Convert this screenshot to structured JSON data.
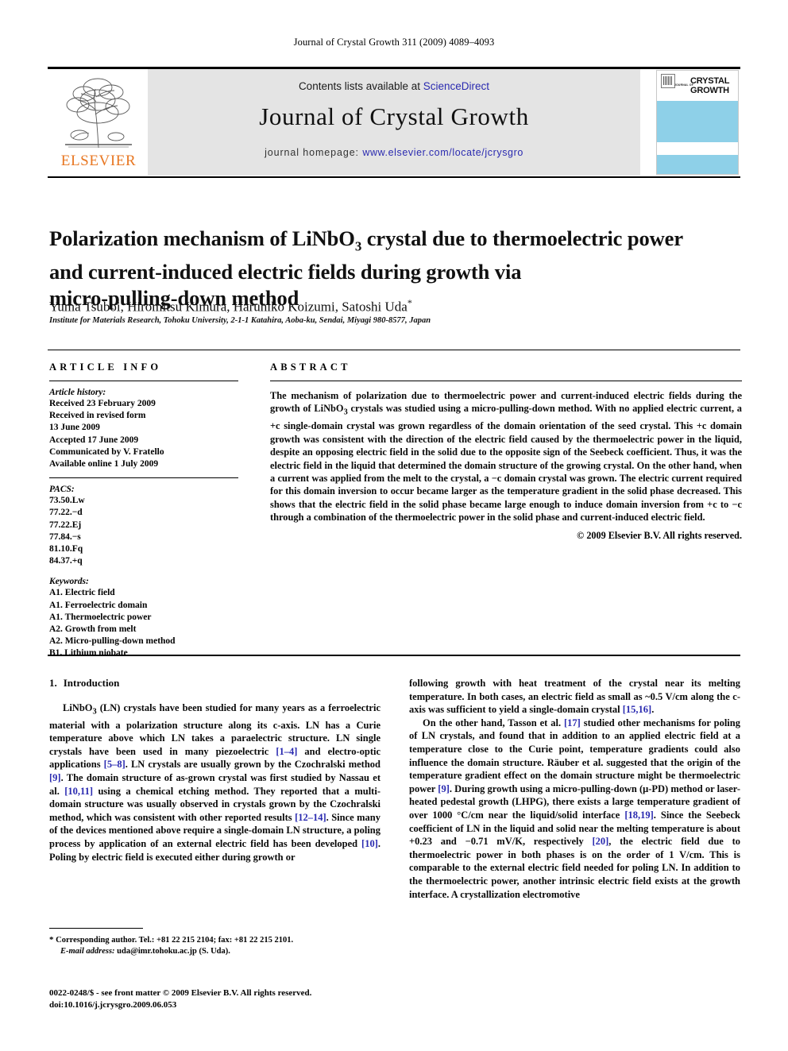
{
  "running_head": "Journal of Crystal Growth 311 (2009) 4089–4093",
  "masthead": {
    "contents_prefix": "Contents lists available at ",
    "sciencedirect": "ScienceDirect",
    "journal_name": "Journal of Crystal Growth",
    "homepage_prefix": "journal homepage: ",
    "homepage_url": "www.elsevier.com/locate/jcrysgro",
    "publisher_wordmark": "ELSEVIER",
    "link_color": "#2a2ab0",
    "band_color": "#e4e4e4",
    "wordmark_color": "#e87722"
  },
  "cover": {
    "subtitle": "JOURNAL OF",
    "title_line1": "CRYSTAL",
    "title_line2": "GROWTH",
    "accent_color": "#8ed0e8"
  },
  "article": {
    "title_line1": "Polarization mechanism of LiNbO",
    "title_sub1": "3",
    "title_line1b": " crystal due to thermoelectric power",
    "title_line2": "and current-induced electric fields during growth via",
    "title_line3": "micro-pulling-down method",
    "authors": "Yuma Tsuboi, Hiromitsu Kimura, Haruhiko Koizumi, Satoshi Uda",
    "corresponding_marker": "*",
    "affiliation": "Institute for Materials Research, Tohoku University, 2-1-1 Katahira, Aoba-ku, Sendai, Miyagi 980-8577, Japan"
  },
  "article_info": {
    "heading": "ARTICLE INFO",
    "history_label": "Article history:",
    "history": [
      "Received 23 February 2009",
      "Received in revised form",
      "13 June 2009",
      "Accepted 17 June 2009",
      "Communicated by V. Fratello",
      "Available online 1 July 2009"
    ],
    "pacs_label": "PACS:",
    "pacs": [
      "73.50.Lw",
      "77.22.−d",
      "77.22.Ej",
      "77.84.−s",
      "81.10.Fq",
      "84.37.+q"
    ],
    "keywords_label": "Keywords:",
    "keywords": [
      "A1. Electric field",
      "A1. Ferroelectric domain",
      "A1. Thermoelectric power",
      "A2. Growth from melt",
      "A2. Micro-pulling-down method",
      "B1. Lithium niobate"
    ]
  },
  "abstract": {
    "heading": "ABSTRACT",
    "text": "The mechanism of polarization due to thermoelectric power and current-induced electric fields during the growth of LiNbO3 crystals was studied using a micro-pulling-down method. With no applied electric current, a +c single-domain crystal was grown regardless of the domain orientation of the seed crystal. This +c domain growth was consistent with the direction of the electric field caused by the thermoelectric power in the liquid, despite an opposing electric field in the solid due to the opposite sign of the Seebeck coefficient. Thus, it was the electric field in the liquid that determined the domain structure of the growing crystal. On the other hand, when a current was applied from the melt to the crystal, a −c domain crystal was grown. The electric current required for this domain inversion to occur became larger as the temperature gradient in the solid phase decreased. This shows that the electric field in the solid phase became large enough to induce domain inversion from +c to −c through a combination of the thermoelectric power in the solid phase and current-induced electric field.",
    "copyright": "© 2009 Elsevier B.V. All rights reserved."
  },
  "section": {
    "number": "1.",
    "title": "Introduction"
  },
  "body": {
    "left_para1_a": "LiNbO",
    "left_para1_b": " (LN) crystals have been studied for many years as a ferroelectric material with a polarization structure along its c-axis. LN has a Curie temperature above which LN takes a paraelectric structure. LN single crystals have been used in many piezoelectric ",
    "left_ref_1_4": "[1–4]",
    "left_para1_c": " and electro-optic applications ",
    "left_ref_5_8": "[5–8]",
    "left_para1_d": ". LN crystals are usually grown by the Czochralski method ",
    "left_ref_9": "[9]",
    "left_para1_e": ". The domain structure of as-grown crystal was first studied by Nassau et al. ",
    "left_ref_10_11": "[10,11]",
    "left_para1_f": " using a chemical etching method. They reported that a multi-domain structure was usually observed in crystals grown by the Czochralski method, which was consistent with other reported results ",
    "left_ref_12_14": "[12–14]",
    "left_para1_g": ". Since many of the devices mentioned above require a single-domain LN structure, a poling process by application of an external electric field has been developed ",
    "left_ref_10": "[10]",
    "left_para1_h": ". Poling by electric field is executed either during growth or",
    "right_para1_a": "following growth with heat treatment of the crystal near its melting temperature. In both cases, an electric field as small as ~0.5 V/cm along the c-axis was sufficient to yield a single-domain crystal ",
    "right_ref_15_16": "[15,16]",
    "right_para1_b": ".",
    "right_para2_a": "On the other hand, Tasson et al. ",
    "right_ref_17": "[17]",
    "right_para2_b": " studied other mechanisms for poling of LN crystals, and found that in addition to an applied electric field at a temperature close to the Curie point, temperature gradients could also influence the domain structure. Räuber et al. suggested that the origin of the temperature gradient effect on the domain structure might be thermoelectric power ",
    "right_ref_9": "[9]",
    "right_para2_c": ". During growth using a micro-pulling-down (μ-PD) method or laser-heated pedestal growth (LHPG), there exists a large temperature gradient of over 1000 °C/cm near the liquid/solid interface ",
    "right_ref_18_19": "[18,19]",
    "right_para2_d": ". Since the Seebeck coefficient of LN in the liquid and solid near the melting temperature is about +0.23 and −0.71 mV/K, respectively ",
    "right_ref_20": "[20]",
    "right_para2_e": ", the electric field due to thermoelectric power in both phases is on the order of 1 V/cm. This is comparable to the external electric field needed for poling LN. In addition to the thermoelectric power, another intrinsic electric field exists at the growth interface. A crystallization electromotive"
  },
  "footnotes": {
    "corresponding_marker": "*",
    "corresponding": " Corresponding author. Tel.: +81 22 215 2104; fax: +81 22 215 2101.",
    "email_label": "E-mail address:",
    "email": " uda@imr.tohoku.ac.jp (S. Uda)."
  },
  "imprint": {
    "line1": "0022-0248/$ - see front matter © 2009 Elsevier B.V. All rights reserved.",
    "line2": "doi:10.1016/j.jcrysgro.2009.06.053"
  }
}
